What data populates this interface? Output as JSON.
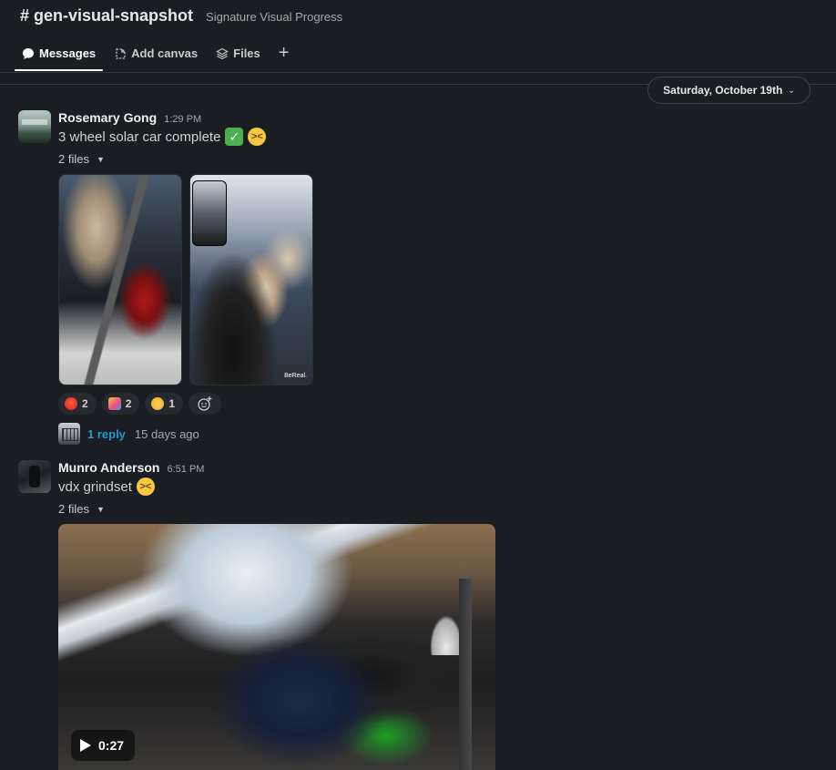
{
  "header": {
    "channel_name": "# gen-visual-snapshot",
    "channel_description": "Signature Visual Progress",
    "tabs": [
      {
        "label": "Messages",
        "icon": "message-bubble-icon",
        "active": true
      },
      {
        "label": "Add canvas",
        "icon": "canvas-icon",
        "active": false
      },
      {
        "label": "Files",
        "icon": "files-stack-icon",
        "active": false
      }
    ],
    "add_tab_icon": "plus-icon"
  },
  "date_divider": {
    "label": "Saturday, October 19th",
    "icon": "chevron-down-icon"
  },
  "messages": [
    {
      "sender": "Rosemary Gong",
      "time": "1:29 PM",
      "text": "3 wheel solar car complete",
      "emojis": [
        "white-check-mark",
        "face-with-steam"
      ],
      "files_label": "2 files",
      "attachments": [
        "photo",
        "photo"
      ],
      "reactions": [
        {
          "emoji": "hot-face",
          "count": "2"
        },
        {
          "emoji": "tada",
          "count": "2"
        },
        {
          "emoji": "face-with-steam",
          "count": "1"
        }
      ],
      "thread": {
        "reply_label": "1 reply",
        "reply_time": "15 days ago"
      }
    },
    {
      "sender": "Munro Anderson",
      "time": "6:51 PM",
      "text": "vdx grindset",
      "emojis": [
        "face-with-steam"
      ],
      "files_label": "2 files",
      "video": {
        "duration": "0:27"
      }
    }
  ],
  "colors": {
    "background": "#1a1d21",
    "link": "#1d9bd1",
    "text": "#d1d2d3"
  }
}
